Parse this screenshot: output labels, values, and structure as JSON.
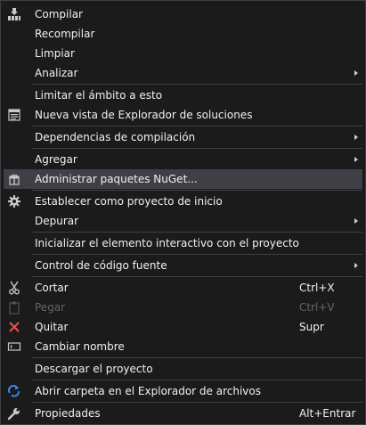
{
  "menu": {
    "compilar": "Compilar",
    "recompilar": "Recompilar",
    "limpiar": "Limpiar",
    "analizar": "Analizar",
    "limitar": "Limitar el ámbito a esto",
    "nueva_vista": "Nueva vista de Explorador de soluciones",
    "dependencias": "Dependencias de compilación",
    "agregar": "Agregar",
    "nuget": "Administrar paquetes NuGet...",
    "establecer": "Establecer como proyecto de inicio",
    "depurar": "Depurar",
    "inicializar": "Inicializar el elemento interactivo con el proyecto",
    "control": "Control de código fuente",
    "cortar": "Cortar",
    "cortar_shortcut": "Ctrl+X",
    "pegar": "Pegar",
    "pegar_shortcut": "Ctrl+V",
    "quitar": "Quitar",
    "quitar_shortcut": "Supr",
    "cambiar": "Cambiar nombre",
    "descargar": "Descargar el proyecto",
    "abrir_carpeta": "Abrir carpeta en el Explorador de archivos",
    "propiedades": "Propiedades",
    "propiedades_shortcut": "Alt+Entrar"
  },
  "icons": {
    "build": "build-icon",
    "solution_view": "solution-explorer-view-icon",
    "nuget": "nuget-package-icon",
    "startup": "gear-icon",
    "cut": "scissors-icon",
    "paste": "clipboard-icon",
    "remove": "red-x-icon",
    "rename": "rename-icon",
    "open_folder": "refresh-arrow-icon",
    "properties": "wrench-icon"
  },
  "colors": {
    "background": "#1b1b1c",
    "hover": "#3f3f46",
    "text": "#f1f1f1",
    "disabled_text": "#656565",
    "remove_icon": "#e8504a",
    "open_folder_icon": "#3794ff"
  }
}
